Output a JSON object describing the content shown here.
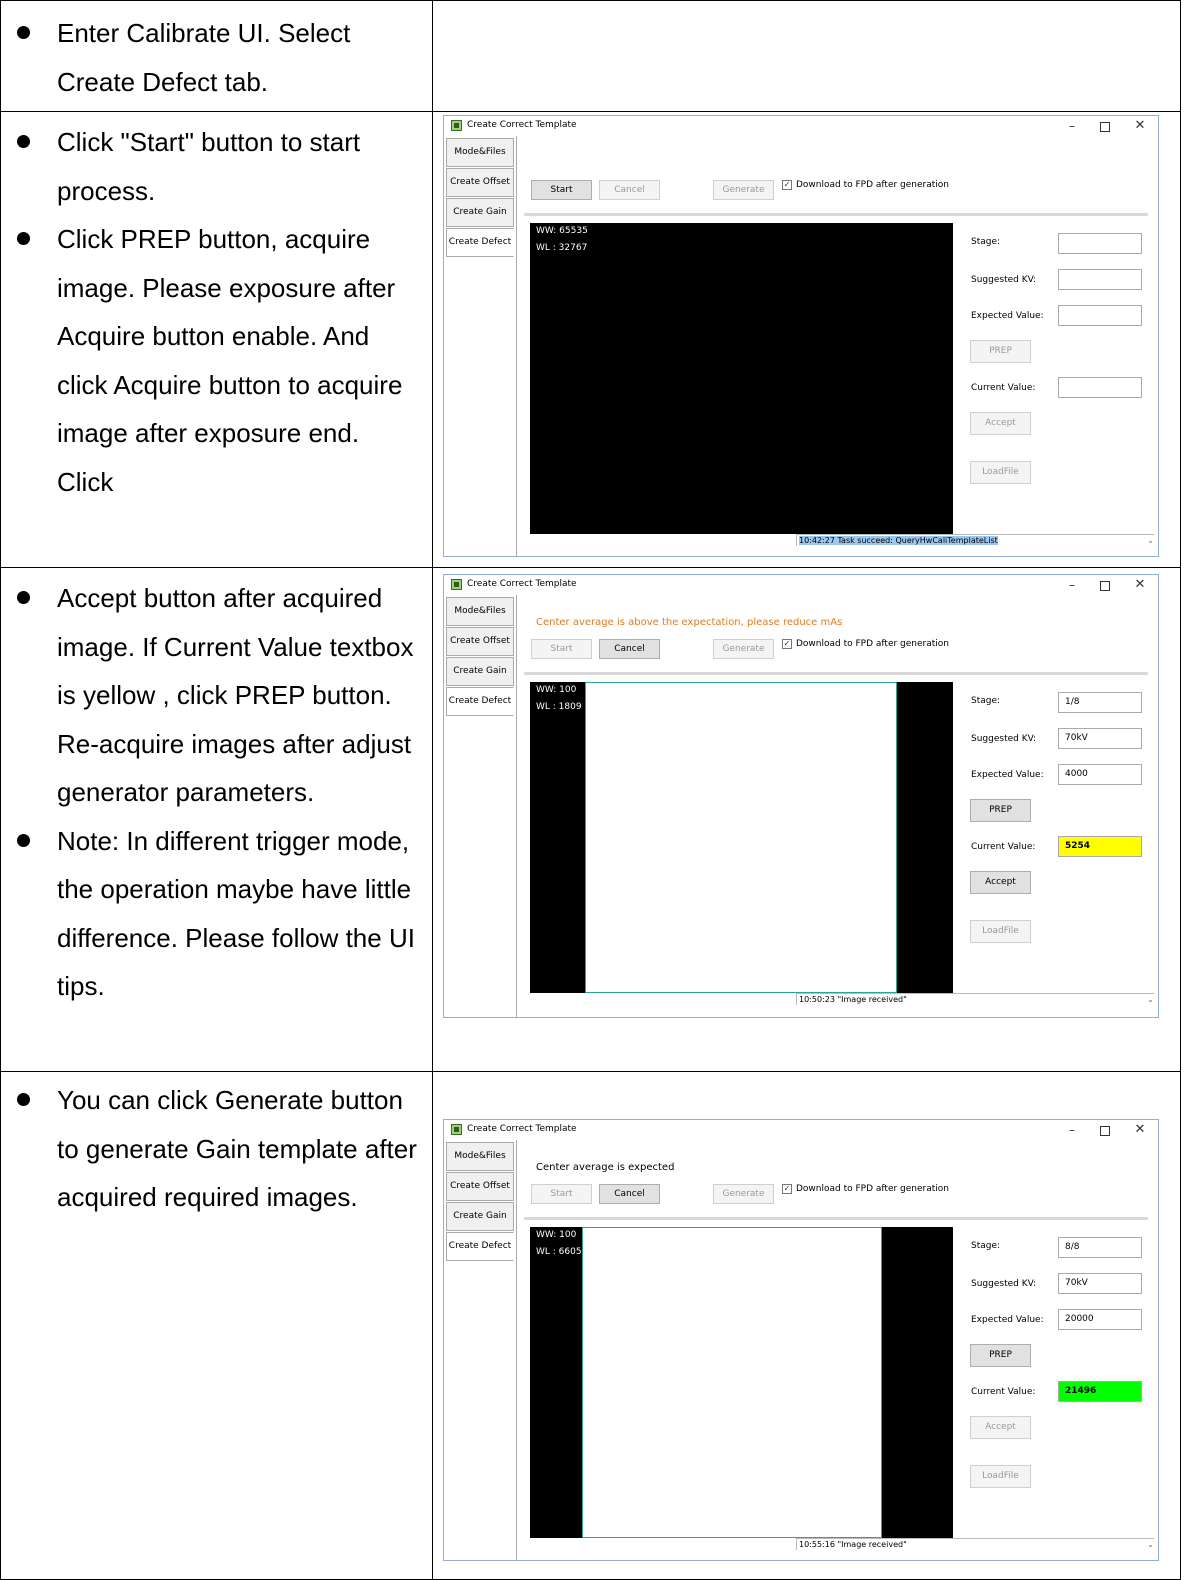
{
  "doc": {
    "rows": [
      {
        "steps": [
          "Enter Calibrate UI. Select Create Defect tab."
        ]
      },
      {
        "steps": [
          "Click \"Start\" button to start process.",
          "Click PREP button, acquire image. Please exposure after Acquire button enable. And click Acquire button to acquire image after exposure end. Click"
        ]
      },
      {
        "steps": [
          "Accept button after acquired image. If Current Value textbox is yellow , click PREP button. Re-acquire images after adjust generator parameters.",
          "Note: In different trigger mode, the operation maybe have little difference. Please follow the UI tips."
        ]
      },
      {
        "steps": [
          "You can click Generate button to generate Gain template after acquired required images."
        ]
      }
    ]
  },
  "windows": [
    {
      "title": "Create Correct Template",
      "tabs": [
        "Mode&Files",
        "Create Offset",
        "Create Gain",
        "Create Defect"
      ],
      "active_tab": "Create Defect",
      "message": "",
      "message_color": "#000000",
      "buttons": {
        "start": "Start",
        "cancel": "Cancel",
        "generate": "Generate"
      },
      "download_label": "Download to FPD after generation",
      "download_checked": true,
      "ww": "WW:  65535",
      "wl": "WL :  32767",
      "fields": {
        "stage_label": "Stage:",
        "stage": "",
        "kv_label": "Suggested KV:",
        "kv": "",
        "expected_label": "Expected Value:",
        "expected": "",
        "current_label": "Current Value:",
        "current": "",
        "current_color": "#ffffff"
      },
      "side_buttons": {
        "prep": "PREP",
        "accept": "Accept",
        "loadfile": "LoadFile"
      },
      "status": "10:42:27 Task succeed: QueryHwCaliTemplateList"
    },
    {
      "title": "Create Correct Template",
      "tabs": [
        "Mode&Files",
        "Create Offset",
        "Create Gain",
        "Create Defect"
      ],
      "active_tab": "Create Defect",
      "message": "Center average is above the expectation, please reduce mAs",
      "message_color": "#e07b20",
      "buttons": {
        "start": "Start",
        "cancel": "Cancel",
        "generate": "Generate"
      },
      "download_label": "Download to FPD after generation",
      "download_checked": true,
      "ww": "WW:  100",
      "wl": "WL :  1809",
      "fields": {
        "stage_label": "Stage:",
        "stage": "1/8",
        "kv_label": "Suggested KV:",
        "kv": "70kV",
        "expected_label": "Expected Value:",
        "expected": "4000",
        "current_label": "Current Value:",
        "current": "5254",
        "current_color": "#ffff00"
      },
      "side_buttons": {
        "prep": "PREP",
        "accept": "Accept",
        "loadfile": "LoadFile"
      },
      "status": "10:50:23 \"Image received\""
    },
    {
      "title": "Create Correct Template",
      "tabs": [
        "Mode&Files",
        "Create Offset",
        "Create Gain",
        "Create Defect"
      ],
      "active_tab": "Create Defect",
      "message": "Center average is expected",
      "message_color": "#000000",
      "buttons": {
        "start": "Start",
        "cancel": "Cancel",
        "generate": "Generate"
      },
      "download_label": "Download to FPD after generation",
      "download_checked": true,
      "ww": "WW:  100",
      "wl": "WL :  6605",
      "fields": {
        "stage_label": "Stage:",
        "stage": "8/8",
        "kv_label": "Suggested KV:",
        "kv": "70kV",
        "expected_label": "Expected Value:",
        "expected": "20000",
        "current_label": "Current Value:",
        "current": "21496",
        "current_color": "#00ff00"
      },
      "side_buttons": {
        "prep": "PREP",
        "accept": "Accept",
        "loadfile": "LoadFile"
      },
      "status": "10:55:16 \"Image received\""
    }
  ]
}
